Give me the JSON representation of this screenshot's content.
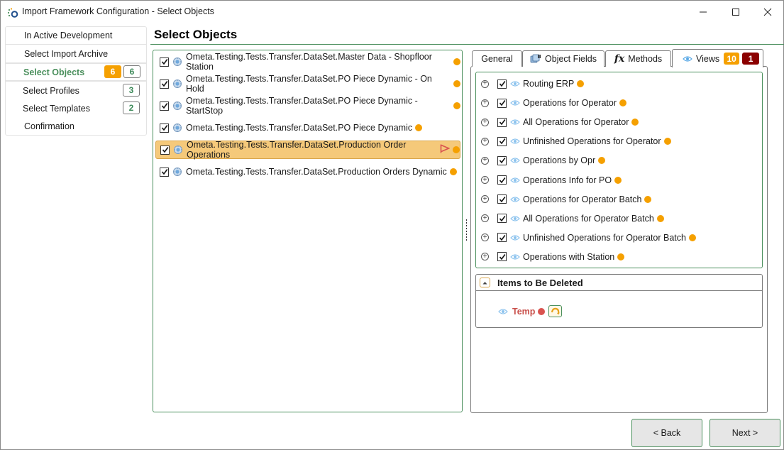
{
  "window": {
    "title": "Import Framework Configuration - Select Objects",
    "controls": {
      "minimize": "minimize",
      "maximize": "maximize",
      "close": "close"
    }
  },
  "sidebar": {
    "items": [
      {
        "label": "In Active Development",
        "state": "normal"
      },
      {
        "label": "Select Import Archive",
        "state": "normal"
      },
      {
        "label": "Select Objects",
        "state": "active",
        "badge_new": "6",
        "badge_total": "6"
      },
      {
        "label": "Select Profiles",
        "state": "normal",
        "badge_total": "3"
      },
      {
        "label": "Select Templates",
        "state": "normal",
        "badge_total": "2"
      },
      {
        "label": "Confirmation",
        "state": "normal"
      }
    ]
  },
  "main": {
    "title": "Select Objects",
    "objects": [
      {
        "name": "Ometa.Testing.Tests.Transfer.DataSet.Master Data - Shopfloor Station",
        "checked": true,
        "status": "changed",
        "selected": false,
        "flagged": false
      },
      {
        "name": "Ometa.Testing.Tests.Transfer.DataSet.PO Piece Dynamic - On Hold",
        "checked": true,
        "status": "changed",
        "selected": false,
        "flagged": false
      },
      {
        "name": "Ometa.Testing.Tests.Transfer.DataSet.PO Piece Dynamic - StartStop",
        "checked": true,
        "status": "changed",
        "selected": false,
        "flagged": false
      },
      {
        "name": "Ometa.Testing.Tests.Transfer.DataSet.PO Piece Dynamic",
        "checked": true,
        "status": "changed",
        "selected": false,
        "flagged": false
      },
      {
        "name": "Ometa.Testing.Tests.Transfer.DataSet.Production Order Operations",
        "checked": true,
        "status": "changed",
        "selected": true,
        "flagged": true
      },
      {
        "name": "Ometa.Testing.Tests.Transfer.DataSet.Production Orders Dynamic",
        "checked": true,
        "status": "changed",
        "selected": false,
        "flagged": false
      }
    ]
  },
  "details": {
    "tabs": [
      {
        "label": "General",
        "icon": ""
      },
      {
        "label": "Object Fields",
        "icon": "object-fields-icon"
      },
      {
        "label": "Methods",
        "icon": "fx-icon"
      },
      {
        "label": "Views",
        "icon": "eye-icon",
        "active": true,
        "badge_count": "10",
        "badge_deleted": "1"
      }
    ],
    "views": [
      {
        "label": "Routing ERP",
        "checked": true
      },
      {
        "label": "Operations for Operator",
        "checked": true
      },
      {
        "label": "All Operations for Operator",
        "checked": true
      },
      {
        "label": "Unfinished Operations for Operator",
        "checked": true
      },
      {
        "label": "Operations by Opr",
        "checked": true
      },
      {
        "label": "Operations Info for PO",
        "checked": true
      },
      {
        "label": "Operations for Operator Batch",
        "checked": true
      },
      {
        "label": "All Operations for Operator Batch",
        "checked": true
      },
      {
        "label": "Unfinished Operations for Operator Batch",
        "checked": true
      },
      {
        "label": "Operations with Station",
        "checked": true
      }
    ],
    "deleted": {
      "title": "Items to Be Deleted",
      "items": [
        {
          "label": "Temp"
        }
      ]
    }
  },
  "footer": {
    "back_label": "< Back",
    "next_label": "Next >"
  },
  "colors": {
    "accent_green": "#4a8f5c",
    "changed_orange": "#f5a000",
    "deleted_red": "#8b0000",
    "selected_row": "#f5c97a",
    "temp_red": "#c9504b"
  }
}
